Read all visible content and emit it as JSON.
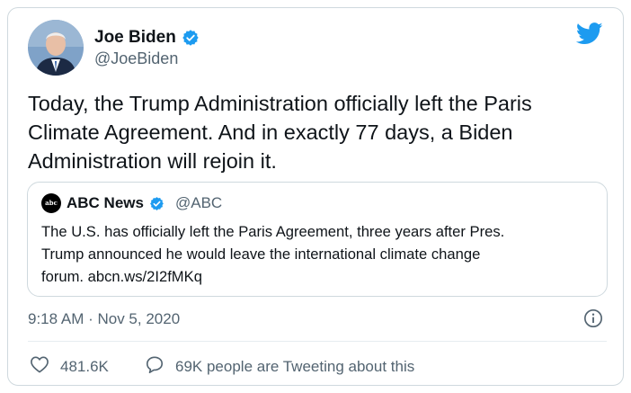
{
  "author": {
    "name": "Joe Biden",
    "handle": "@JoeBiden",
    "avatar_icon": "profile-photo",
    "verified": true
  },
  "tweet": {
    "text": "Today, the Trump Administration officially left the Paris\nClimate Agreement. And in exactly 77 days, a Biden\nAdministration will rejoin it.",
    "timestamp": "9:18 AM · Nov 5, 2020"
  },
  "quoted_tweet": {
    "avatar_text": "abc NEWS",
    "name": "ABC News",
    "handle": "@ABC",
    "verified": true,
    "text": "The U.S. has officially left the Paris Agreement, three years after Pres.\nTrump announced he would leave the international climate change\nforum. abcn.ws/2I2fMKq"
  },
  "actions": {
    "likes": "481.6K",
    "conversation": "69K people are Tweeting about this"
  },
  "colors": {
    "twitter_blue": "#1d9bf0",
    "muted": "#536471",
    "border": "#cfd9de"
  },
  "icons": [
    "twitter-bird-icon",
    "verified-badge-icon",
    "info-icon",
    "heart-icon",
    "speech-bubble-icon"
  ]
}
